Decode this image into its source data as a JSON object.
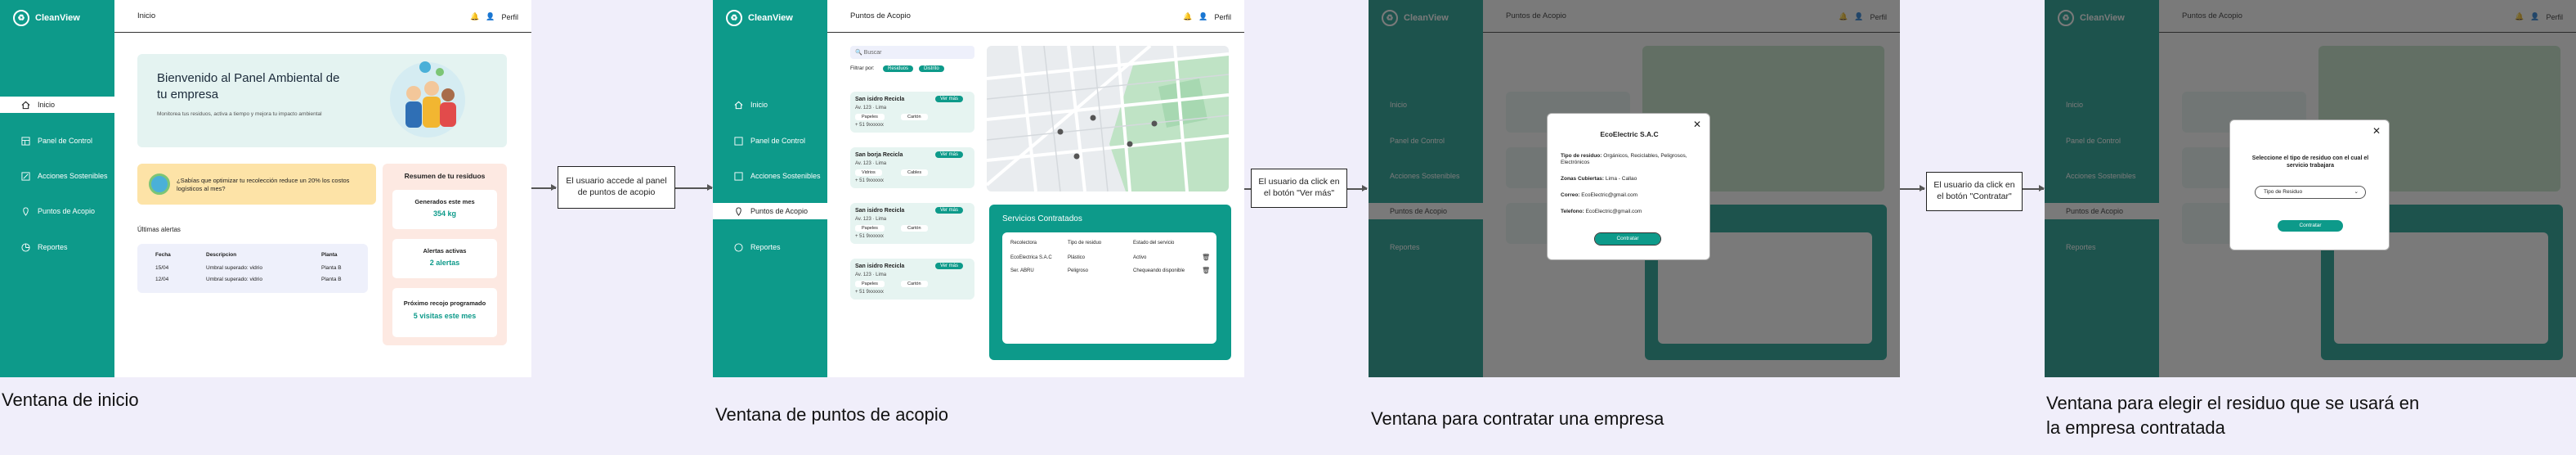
{
  "app_name": "CleanView",
  "user": {
    "profile_label": "Perfil"
  },
  "nav": [
    {
      "label": "Inicio"
    },
    {
      "label": "Panel de Control"
    },
    {
      "label": "Acciones Sostenibles"
    },
    {
      "label": "Puntos de Acopio"
    },
    {
      "label": "Reportes"
    }
  ],
  "screen1": {
    "page_title": "Inicio",
    "welcome_title": "Bienvenido al Panel Ambiental de tu empresa",
    "welcome_sub": "Monitorea tus residuos, activa a tiempo y mejora tu impacto ambiental",
    "tip": "¿Sabías que optimizar tu recolección reduce un 20% los costos logísticos al mes?",
    "alerts_title": "Últimas alertas",
    "alerts_headers": [
      "Fecha",
      "Descripcion",
      "Planta"
    ],
    "alerts_rows": [
      [
        "15/04",
        "Umbral superado: vidrio",
        "Planta B"
      ],
      [
        "12/04",
        "Umbral superado: vidrio",
        "Planta B"
      ]
    ],
    "summary_title": "Resumen de tu residuos",
    "summary": [
      {
        "label": "Generados este mes",
        "value": "354 kg"
      },
      {
        "label": "Alertas activas",
        "value": "2 alertas"
      },
      {
        "label": "Próximo recojo programado",
        "value": "5 visitas este mes"
      }
    ],
    "caption": "Ventana de inicio"
  },
  "note1": "El usuario accede al panel de puntos de acopio",
  "screen2": {
    "page_title": "Puntos de Acopio",
    "search_placeholder": "Buscar",
    "filter_label": "Filtrar por:",
    "filter_chips": [
      "Residuos",
      "Distrito"
    ],
    "companies": [
      {
        "name": "San isidro Recicla",
        "address": "Av. 123 · Lima",
        "tags": [
          "Papeles",
          "Cartón"
        ],
        "phone": "+ 51 9xxxxxx",
        "button": "Ver más"
      },
      {
        "name": "San borja Recicla",
        "address": "Av. 123 · Lima",
        "tags": [
          "Vidrios",
          "Cables"
        ],
        "phone": "+ 51 9xxxxxx",
        "button": "Ver más"
      },
      {
        "name": "San isidro Recicla",
        "address": "Av. 123 · Lima",
        "tags": [
          "Papeles",
          "Cartón"
        ],
        "phone": "+ 51 9xxxxxx",
        "button": "Ver más"
      },
      {
        "name": "San isidro Recicla",
        "address": "Av. 123 · Lima",
        "tags": [
          "Papeles",
          "Cartón"
        ],
        "phone": "+ 51 9xxxxxx",
        "button": "Ver más"
      }
    ],
    "contracted_title": "Servicios Contratados",
    "contracted_headers": [
      "Recolectora",
      "Tipo de residuo",
      "Estado del servicio"
    ],
    "contracted_rows": [
      [
        "EcoElectrica S.A.C",
        "Plástico",
        "Activo"
      ],
      [
        "Ser. ABRU",
        "Peligroso",
        "Chequeando disponible"
      ]
    ],
    "caption": "Ventana de puntos de acopio"
  },
  "note2": "El usuario da click en el botón \"Ver más\"",
  "screen3": {
    "modal_title": "EcoElectric S.A.C",
    "fields": [
      {
        "label": "Tipo de residuo:",
        "value": "Orgánicos, Reciclables, Peligrosos, Electrónicos"
      },
      {
        "label": "Zonas Cubiertas:",
        "value": "Lima - Callao"
      },
      {
        "label": "Correo:",
        "value": "EcoElectric@gmail.com"
      },
      {
        "label": "Telefono:",
        "value": "EcoElectric@gmail.com"
      }
    ],
    "contract_button": "Contratar",
    "caption": "Ventana para contratar una empresa"
  },
  "note3": "El usuario da click en el botón \"Contratar\"",
  "screen4": {
    "modal_title": "Seleccione el tipo de residuo con el cual el servicio trabajara",
    "select_value": "Tipo de Residuo",
    "confirm_button": "Contratar",
    "caption": "Ventana para elegir el residuo que se usará en la empresa contratada"
  },
  "colors": {
    "primary": "#0d9a8a",
    "background": "#f0eefa",
    "tip": "#fde3a7"
  },
  "icons": [
    "home-icon",
    "dashboard-icon",
    "leaf-icon",
    "pin-icon",
    "report-icon",
    "bell-icon",
    "user-icon",
    "search-icon",
    "trash-icon",
    "close-icon",
    "chevron-down-icon"
  ]
}
